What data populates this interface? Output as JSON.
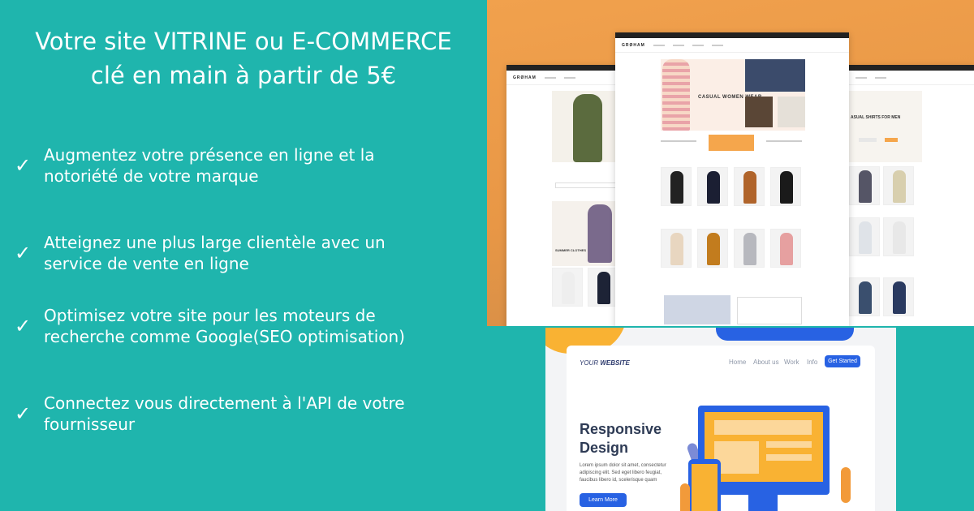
{
  "headline": {
    "line1": "Votre site VITRINE ou E-COMMERCE",
    "line2": "clé en main à partir de 5€"
  },
  "benefits": [
    {
      "check": "✓",
      "line1": "Augmentez votre présence en ligne et la",
      "line2": "notoriété de votre marque"
    },
    {
      "check": "✓",
      "line1": "Atteignez une plus large clientèle avec un",
      "line2": "service de vente en ligne"
    },
    {
      "check": "✓",
      "line1": "Optimisez votre site pour les moteurs de",
      "line2": "recherche comme Google(SEO optimisation)"
    },
    {
      "check": "✓",
      "line1": "Connectez vous directement à l'API de votre",
      "line2": "fournisseur"
    }
  ],
  "shop_preview": {
    "logo": "GRØHAM",
    "hero_caption": "CASUAL WOMEN WEAR",
    "right_caption": "ASUAL SHIRTS FOR MEN",
    "left_caption": "SUMMER CLOTHES"
  },
  "responsive_preview": {
    "brand_prefix": "YOUR",
    "brand_name": "WEBSITE",
    "nav": [
      "Home",
      "About us",
      "Work",
      "Info"
    ],
    "cta": "Get Started",
    "title_line1": "Responsive",
    "title_line2": "Design",
    "body": "Lorem ipsum dolor sit amet, consectetur adipiscing elit. Sed eget libero feugiat, faucibus libero id, scelerisque quam",
    "button": "Learn More"
  }
}
